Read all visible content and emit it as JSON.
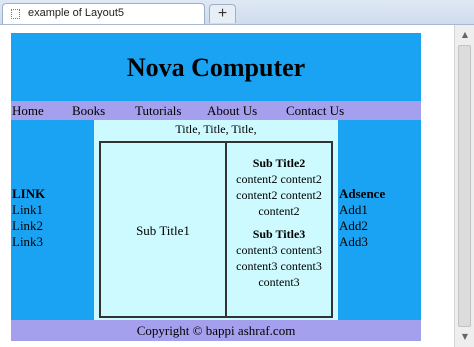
{
  "browser": {
    "tab_title": "example of Layout5",
    "new_tab_symbol": "+"
  },
  "page": {
    "header_title": "Nova Computer",
    "nav": [
      "Home",
      "Books",
      "Tutorials",
      "About Us",
      "Contact Us"
    ],
    "left_sidebar": {
      "heading": "LINK",
      "links": [
        "Link1",
        "Link2",
        "Link3"
      ]
    },
    "main": {
      "title": "Title, Title, Title,",
      "left_box": "Sub Title1",
      "right_box": {
        "sub2_title": "Sub Title2",
        "sub2_lines": [
          "content2 content2",
          "content2 content2",
          "content2"
        ],
        "sub3_title": "Sub Title3",
        "sub3_lines": [
          "content3 content3",
          "content3 content3",
          "content3"
        ]
      }
    },
    "right_sidebar": {
      "heading": "Adsence",
      "links": [
        "Add1",
        "Add2",
        "Add3"
      ]
    },
    "footer": "Copyright © bappi ashraf.com"
  },
  "colors": {
    "header_bg": "#1aa3f2",
    "nav_bg": "#a5a0ee",
    "main_bg": "#ccfaff"
  },
  "icons": {
    "tab": "page-icon",
    "scroll_up": "arrow-up-icon",
    "scroll_down": "arrow-down-icon"
  }
}
